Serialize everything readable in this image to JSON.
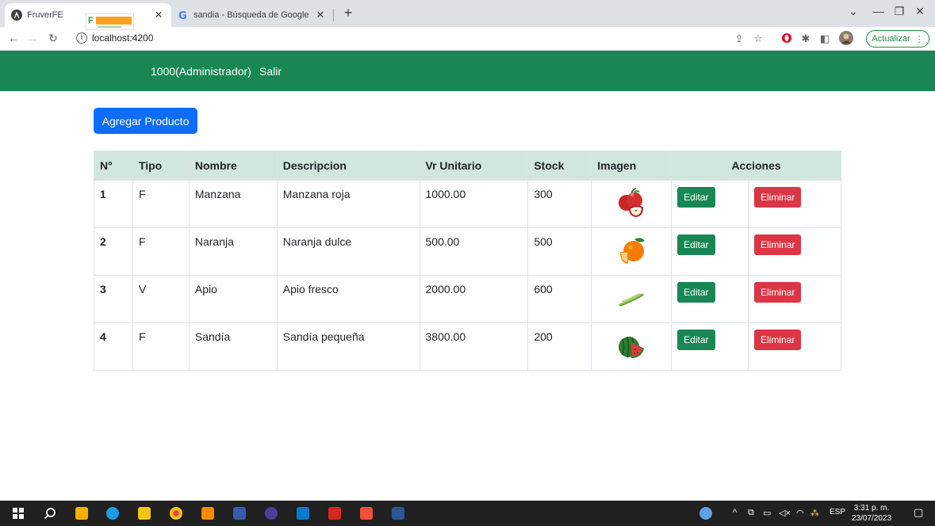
{
  "browser": {
    "tabs": [
      {
        "title": "FruverFE",
        "active": true
      },
      {
        "title": "sandia - Búsqueda de Google",
        "active": false
      }
    ],
    "address": "localhost:4200",
    "update_label": "Actualizar"
  },
  "navbar": {
    "user": "1000(Administrador)",
    "logout": "Salir"
  },
  "main": {
    "add_button": "Agregar Producto",
    "table": {
      "headers": [
        "N°",
        "Tipo",
        "Nombre",
        "Descripcion",
        "Vr Unitario",
        "Stock",
        "Imagen",
        "Acciones"
      ],
      "rows": [
        {
          "num": "1",
          "tipo": "F",
          "nombre": "Manzana",
          "descripcion": "Manzana roja",
          "vr_unitario": "1000.00",
          "stock": "300",
          "image": "apple-image"
        },
        {
          "num": "2",
          "tipo": "F",
          "nombre": "Naranja",
          "descripcion": "Naranja dulce",
          "vr_unitario": "500.00",
          "stock": "500",
          "image": "orange-image"
        },
        {
          "num": "3",
          "tipo": "V",
          "nombre": "Apio",
          "descripcion": "Apio fresco",
          "vr_unitario": "2000.00",
          "stock": "600",
          "image": "celery-image"
        },
        {
          "num": "4",
          "tipo": "F",
          "nombre": "Sandía",
          "descripcion": "Sandía pequeña",
          "vr_unitario": "3800.00",
          "stock": "200",
          "image": "watermelon-image"
        }
      ],
      "edit_label": "Editar",
      "delete_label": "Eliminar"
    }
  },
  "taskbar": {
    "language": "ESP",
    "time": "3:31 p. m.",
    "date": "23/07/2023"
  },
  "colors": {
    "navbar": "#198754",
    "primary": "#0d6efd",
    "danger": "#dc3545",
    "table_header": "#d1e7dd"
  }
}
